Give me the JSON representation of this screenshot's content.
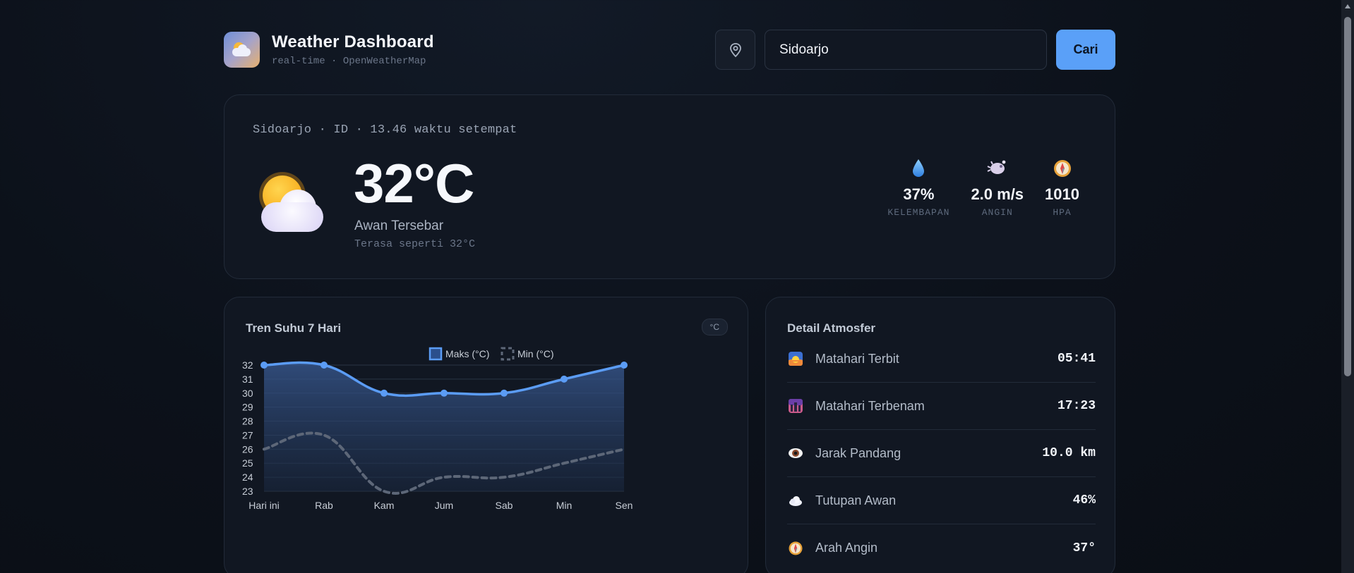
{
  "header": {
    "title": "Weather Dashboard",
    "subtitle": "real-time · OpenWeatherMap",
    "logo_icon": "sun-cloud-icon"
  },
  "search": {
    "value": "Sidoarjo",
    "button_label": "Cari",
    "location_icon": "map-pin-icon"
  },
  "current": {
    "meta": "Sidoarjo · ID · 13.46 waktu setempat",
    "temperature": "32°C",
    "description": "Awan Tersebar",
    "feels_like": "Terasa seperti 32°C",
    "icon": "sun-behind-cloud-icon",
    "stats": [
      {
        "icon": "droplet-icon",
        "value": "37%",
        "label": "KELEMBAPAN"
      },
      {
        "icon": "wind-icon",
        "value": "2.0 m/s",
        "label": "ANGIN"
      },
      {
        "icon": "compass-icon",
        "value": "1010",
        "label": "HPA"
      }
    ]
  },
  "chart_panel": {
    "title": "Tren Suhu 7 Hari",
    "unit_badge": "°C"
  },
  "chart_data": {
    "type": "line",
    "title": "Tren Suhu 7 Hari",
    "categories": [
      "Hari ini",
      "Rab",
      "Kam",
      "Jum",
      "Sab",
      "Min",
      "Sen"
    ],
    "series": [
      {
        "name": "Maks (°C)",
        "values": [
          32,
          32,
          30,
          30,
          30,
          31,
          32
        ],
        "color": "#5b9cf5",
        "style": "solid-area"
      },
      {
        "name": "Min (°C)",
        "values": [
          26,
          27,
          23,
          24,
          24,
          25,
          26
        ],
        "color": "#5d6778",
        "style": "dashed"
      }
    ],
    "yticks": [
      32,
      31,
      30,
      29,
      28,
      27,
      26,
      25,
      24,
      23
    ],
    "ylim": [
      23,
      32
    ],
    "legend": "top-center",
    "grid": true
  },
  "details": {
    "title": "Detail Atmosfer",
    "rows": [
      {
        "icon": "sunrise-icon",
        "label": "Matahari Terbit",
        "value": "05:41"
      },
      {
        "icon": "sunset-icon",
        "label": "Matahari Terbenam",
        "value": "17:23"
      },
      {
        "icon": "eye-icon",
        "label": "Jarak Pandang",
        "value": "10.0 km"
      },
      {
        "icon": "cloud-icon",
        "label": "Tutupan Awan",
        "value": "46%"
      },
      {
        "icon": "compass-icon",
        "label": "Arah Angin",
        "value": "37°"
      }
    ]
  }
}
